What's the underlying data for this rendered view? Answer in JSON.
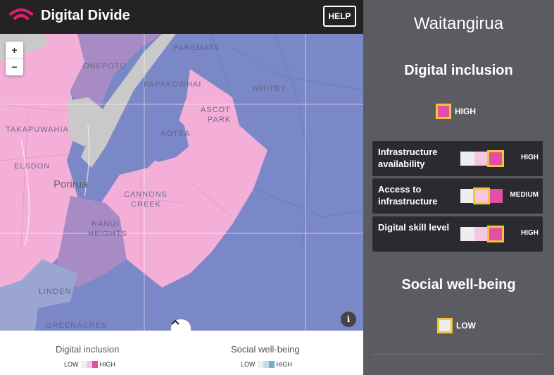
{
  "app": {
    "title": "Digital Divide",
    "help_label": "HELP"
  },
  "map": {
    "zoom_in": "+",
    "zoom_out": "−",
    "info_label": "i",
    "labels": {
      "paremata": "PAREMATA",
      "onepoto": "ONEPOTO",
      "papakowhai": "PAPAKOWHAI",
      "whitby": "WHITBY",
      "takapuwahia": "TAKAPUWAHIA",
      "ascot_park_1": "ASCOT",
      "ascot_park_2": "PARK",
      "aotea": "AOTEA",
      "elsdon": "ELSDON",
      "porirua": "Porirua",
      "cannons_creek_1": "CANNONS",
      "cannons_creek_2": "CREEK",
      "ranui_1": "RANUI",
      "ranui_2": "HEIGHTS",
      "linden": "LINDEN",
      "greenacres": "GREENACRES"
    },
    "colors": {
      "high_pink": "#f4afd8",
      "low_blue": "#7b88c7",
      "mid_purple": "#a88bc4",
      "water": "#c9c9c9",
      "grey_blue": "#9aa6cf"
    }
  },
  "legend": {
    "digital": {
      "title": "Digital inclusion",
      "low": "LOW",
      "high": "HIGH",
      "colors": [
        "#eeeeee",
        "#f6c5e2",
        "#e44fa6"
      ]
    },
    "social": {
      "title": "Social well-being",
      "low": "LOW",
      "high": "HIGH",
      "colors": [
        "#eeeeee",
        "#bfdde3",
        "#6fb4c3"
      ]
    }
  },
  "panel": {
    "region": "Waitangirua",
    "digital_inclusion": {
      "title": "Digital inclusion",
      "level": "HIGH",
      "color": "#e44fa6"
    },
    "metrics": [
      {
        "label": "Infrastructure availability",
        "value": "HIGH",
        "selected": 2
      },
      {
        "label": "Access to infrastructure",
        "value": "MEDIUM",
        "selected": 1
      },
      {
        "label": "Digital skill level",
        "value": "HIGH",
        "selected": 2
      }
    ],
    "metric_colors": [
      "#eeeeee",
      "#f6c5e2",
      "#e44fa6"
    ],
    "social_wellbeing": {
      "title": "Social well-being",
      "level": "LOW",
      "color": "#eeeeee"
    },
    "accent_color": "#f3c63a"
  }
}
